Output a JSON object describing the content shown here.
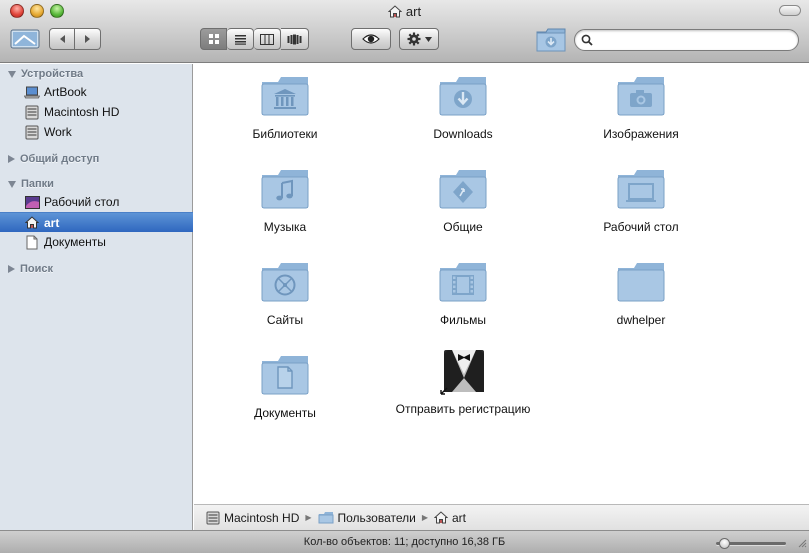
{
  "window": {
    "title": "art"
  },
  "toolbar": {
    "search_placeholder": "",
    "view_modes": [
      "icons",
      "list",
      "columns",
      "cover-flow"
    ],
    "selected_view": "icons"
  },
  "sidebar": {
    "sections": [
      {
        "label": "Устройства",
        "expanded": true,
        "items": [
          {
            "label": "ArtBook",
            "icon": "laptop-icon"
          },
          {
            "label": "Macintosh HD",
            "icon": "hard-drive-icon"
          },
          {
            "label": "Work",
            "icon": "hard-drive-icon"
          }
        ]
      },
      {
        "label": "Общий доступ",
        "expanded": false,
        "items": []
      },
      {
        "label": "Папки",
        "expanded": true,
        "items": [
          {
            "label": "Рабочий стол",
            "icon": "desktop-icon"
          },
          {
            "label": "art",
            "icon": "home-icon",
            "selected": true
          },
          {
            "label": "Документы",
            "icon": "document-icon"
          }
        ]
      },
      {
        "label": "Поиск",
        "expanded": false,
        "items": []
      }
    ]
  },
  "content": {
    "items": [
      {
        "label": "Библиотеки",
        "icon": "library-folder-icon"
      },
      {
        "label": "Downloads",
        "icon": "downloads-folder-icon"
      },
      {
        "label": "Изображения",
        "icon": "pictures-folder-icon"
      },
      {
        "label": "Музыка",
        "icon": "music-folder-icon"
      },
      {
        "label": "Общие",
        "icon": "public-folder-icon"
      },
      {
        "label": "Рабочий стол",
        "icon": "desktop-folder-icon"
      },
      {
        "label": "Сайты",
        "icon": "sites-folder-icon"
      },
      {
        "label": "Фильмы",
        "icon": "movies-folder-icon"
      },
      {
        "label": "dwhelper",
        "icon": "generic-folder-icon"
      },
      {
        "label": "Документы",
        "icon": "documents-folder-icon"
      },
      {
        "label": "Отправить регистрацию",
        "icon": "registration-app-icon"
      }
    ]
  },
  "pathbar": {
    "crumbs": [
      {
        "label": "Macintosh HD",
        "icon": "hard-drive-icon"
      },
      {
        "label": "Пользователи",
        "icon": "folder-icon"
      },
      {
        "label": "art",
        "icon": "home-icon"
      }
    ]
  },
  "status": {
    "text": "Кол-во объектов: 11; доступно 16,38 ГБ",
    "icon_size_level": 0.1
  },
  "colors": {
    "folder_blue": "#8fb4d8",
    "sidebar_bg": "#dde4ec",
    "selection": "#3a72c6"
  }
}
